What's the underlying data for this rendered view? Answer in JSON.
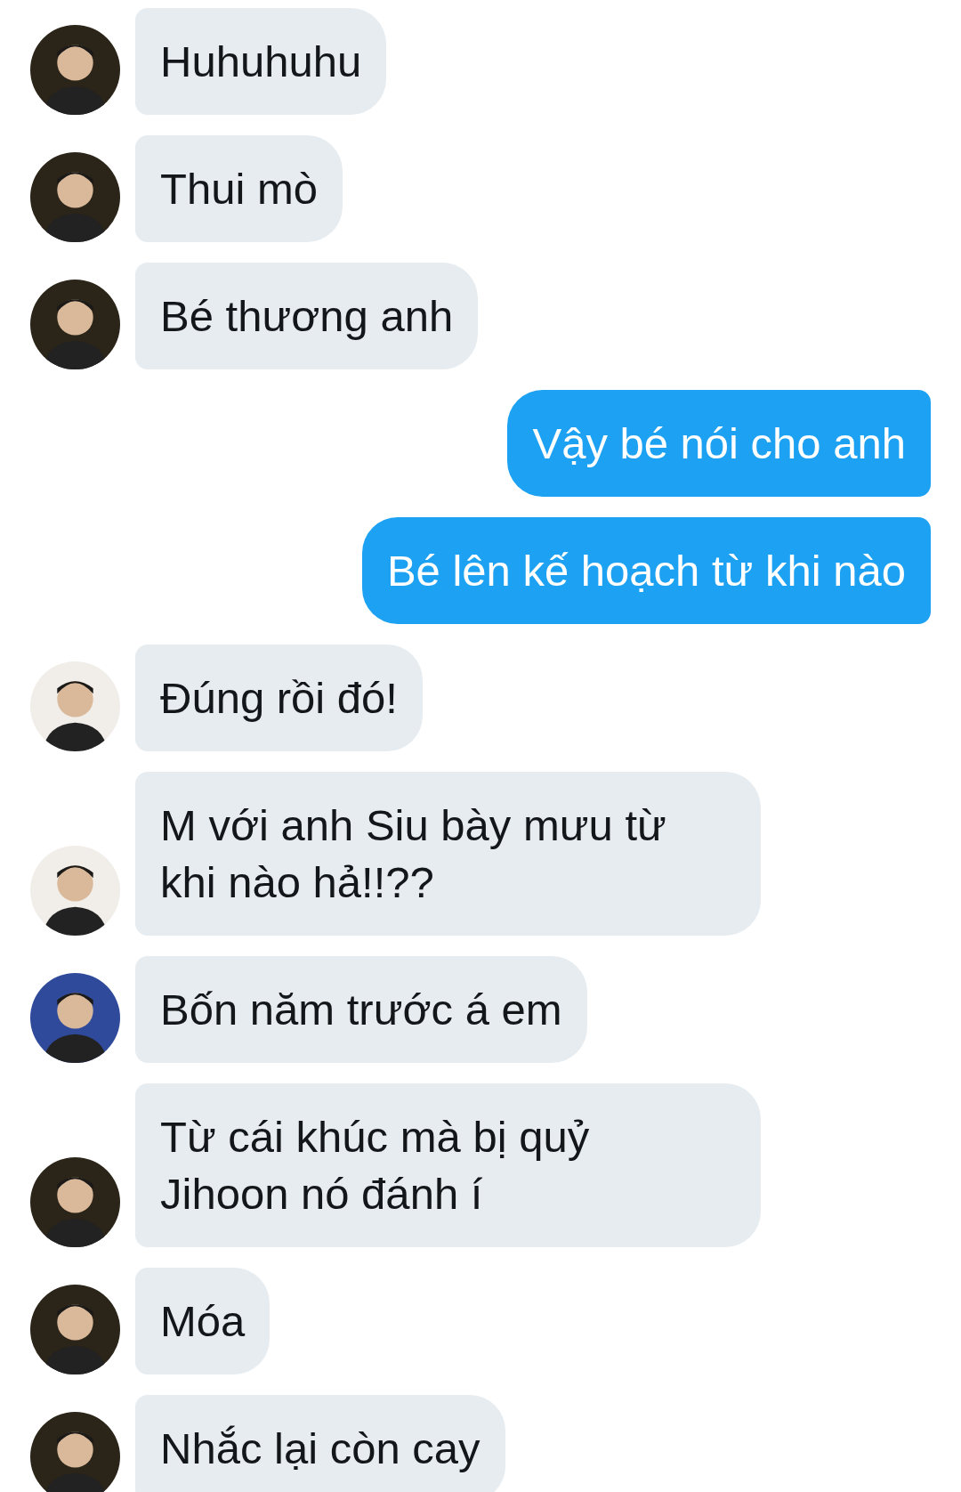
{
  "messages": [
    {
      "kind": "incoming",
      "color": "#2b2418",
      "lines": [
        "Huhuhuhu"
      ]
    },
    {
      "kind": "incoming",
      "color": "#2b2418",
      "lines": [
        "Thui mò"
      ]
    },
    {
      "kind": "incoming",
      "color": "#2b2418",
      "lines": [
        "Bé thương anh"
      ]
    },
    {
      "kind": "outgoing",
      "lines": [
        "Vậy bé nói cho anh"
      ]
    },
    {
      "kind": "outgoing",
      "lines": [
        "Bé lên kế hoạch từ khi nào"
      ]
    },
    {
      "kind": "incoming",
      "color": "#f1ede8",
      "lines": [
        "Đúng rồi đó!"
      ]
    },
    {
      "kind": "incoming",
      "color": "#f1ede8",
      "lines": [
        "M với anh Siu bày mưu từ",
        "khi nào hả!!??"
      ]
    },
    {
      "kind": "incoming",
      "color": "#2f4a9a",
      "lines": [
        "Bốn năm trước á em"
      ]
    },
    {
      "kind": "incoming",
      "color": "#2b2418",
      "lines": [
        "Từ cái khúc mà bị quỷ",
        "Jihoon nó đánh í"
      ]
    },
    {
      "kind": "incoming",
      "color": "#2b2418",
      "lines": [
        "Móa"
      ]
    },
    {
      "kind": "incoming",
      "color": "#2b2418",
      "lines": [
        "Nhắc lại còn cay"
      ]
    }
  ]
}
